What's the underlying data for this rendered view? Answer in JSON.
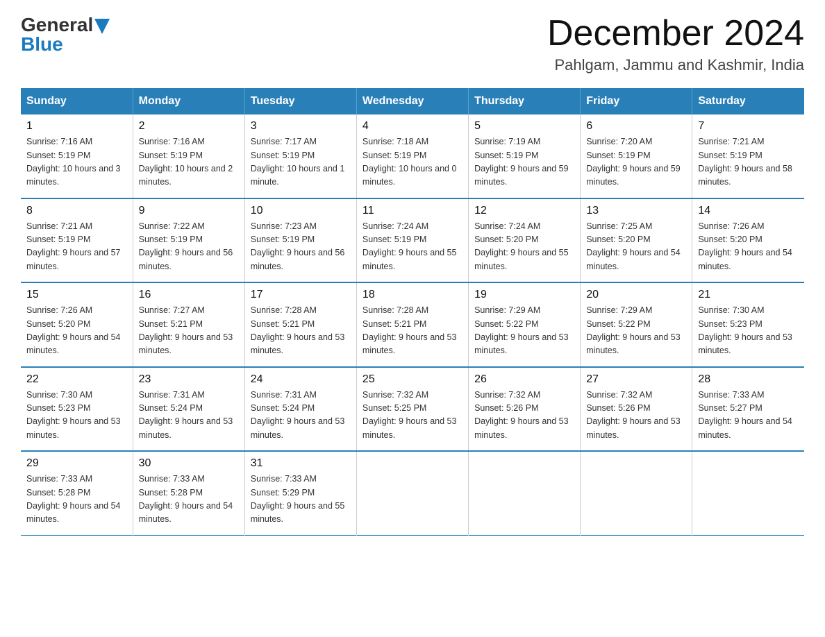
{
  "header": {
    "logo_general": "General",
    "logo_blue": "Blue",
    "month_title": "December 2024",
    "location": "Pahlgam, Jammu and Kashmir, India"
  },
  "days_of_week": [
    "Sunday",
    "Monday",
    "Tuesday",
    "Wednesday",
    "Thursday",
    "Friday",
    "Saturday"
  ],
  "weeks": [
    [
      {
        "day": "1",
        "sunrise": "7:16 AM",
        "sunset": "5:19 PM",
        "daylight": "10 hours and 3 minutes."
      },
      {
        "day": "2",
        "sunrise": "7:16 AM",
        "sunset": "5:19 PM",
        "daylight": "10 hours and 2 minutes."
      },
      {
        "day": "3",
        "sunrise": "7:17 AM",
        "sunset": "5:19 PM",
        "daylight": "10 hours and 1 minute."
      },
      {
        "day": "4",
        "sunrise": "7:18 AM",
        "sunset": "5:19 PM",
        "daylight": "10 hours and 0 minutes."
      },
      {
        "day": "5",
        "sunrise": "7:19 AM",
        "sunset": "5:19 PM",
        "daylight": "9 hours and 59 minutes."
      },
      {
        "day": "6",
        "sunrise": "7:20 AM",
        "sunset": "5:19 PM",
        "daylight": "9 hours and 59 minutes."
      },
      {
        "day": "7",
        "sunrise": "7:21 AM",
        "sunset": "5:19 PM",
        "daylight": "9 hours and 58 minutes."
      }
    ],
    [
      {
        "day": "8",
        "sunrise": "7:21 AM",
        "sunset": "5:19 PM",
        "daylight": "9 hours and 57 minutes."
      },
      {
        "day": "9",
        "sunrise": "7:22 AM",
        "sunset": "5:19 PM",
        "daylight": "9 hours and 56 minutes."
      },
      {
        "day": "10",
        "sunrise": "7:23 AM",
        "sunset": "5:19 PM",
        "daylight": "9 hours and 56 minutes."
      },
      {
        "day": "11",
        "sunrise": "7:24 AM",
        "sunset": "5:19 PM",
        "daylight": "9 hours and 55 minutes."
      },
      {
        "day": "12",
        "sunrise": "7:24 AM",
        "sunset": "5:20 PM",
        "daylight": "9 hours and 55 minutes."
      },
      {
        "day": "13",
        "sunrise": "7:25 AM",
        "sunset": "5:20 PM",
        "daylight": "9 hours and 54 minutes."
      },
      {
        "day": "14",
        "sunrise": "7:26 AM",
        "sunset": "5:20 PM",
        "daylight": "9 hours and 54 minutes."
      }
    ],
    [
      {
        "day": "15",
        "sunrise": "7:26 AM",
        "sunset": "5:20 PM",
        "daylight": "9 hours and 54 minutes."
      },
      {
        "day": "16",
        "sunrise": "7:27 AM",
        "sunset": "5:21 PM",
        "daylight": "9 hours and 53 minutes."
      },
      {
        "day": "17",
        "sunrise": "7:28 AM",
        "sunset": "5:21 PM",
        "daylight": "9 hours and 53 minutes."
      },
      {
        "day": "18",
        "sunrise": "7:28 AM",
        "sunset": "5:21 PM",
        "daylight": "9 hours and 53 minutes."
      },
      {
        "day": "19",
        "sunrise": "7:29 AM",
        "sunset": "5:22 PM",
        "daylight": "9 hours and 53 minutes."
      },
      {
        "day": "20",
        "sunrise": "7:29 AM",
        "sunset": "5:22 PM",
        "daylight": "9 hours and 53 minutes."
      },
      {
        "day": "21",
        "sunrise": "7:30 AM",
        "sunset": "5:23 PM",
        "daylight": "9 hours and 53 minutes."
      }
    ],
    [
      {
        "day": "22",
        "sunrise": "7:30 AM",
        "sunset": "5:23 PM",
        "daylight": "9 hours and 53 minutes."
      },
      {
        "day": "23",
        "sunrise": "7:31 AM",
        "sunset": "5:24 PM",
        "daylight": "9 hours and 53 minutes."
      },
      {
        "day": "24",
        "sunrise": "7:31 AM",
        "sunset": "5:24 PM",
        "daylight": "9 hours and 53 minutes."
      },
      {
        "day": "25",
        "sunrise": "7:32 AM",
        "sunset": "5:25 PM",
        "daylight": "9 hours and 53 minutes."
      },
      {
        "day": "26",
        "sunrise": "7:32 AM",
        "sunset": "5:26 PM",
        "daylight": "9 hours and 53 minutes."
      },
      {
        "day": "27",
        "sunrise": "7:32 AM",
        "sunset": "5:26 PM",
        "daylight": "9 hours and 53 minutes."
      },
      {
        "day": "28",
        "sunrise": "7:33 AM",
        "sunset": "5:27 PM",
        "daylight": "9 hours and 54 minutes."
      }
    ],
    [
      {
        "day": "29",
        "sunrise": "7:33 AM",
        "sunset": "5:28 PM",
        "daylight": "9 hours and 54 minutes."
      },
      {
        "day": "30",
        "sunrise": "7:33 AM",
        "sunset": "5:28 PM",
        "daylight": "9 hours and 54 minutes."
      },
      {
        "day": "31",
        "sunrise": "7:33 AM",
        "sunset": "5:29 PM",
        "daylight": "9 hours and 55 minutes."
      },
      null,
      null,
      null,
      null
    ]
  ]
}
